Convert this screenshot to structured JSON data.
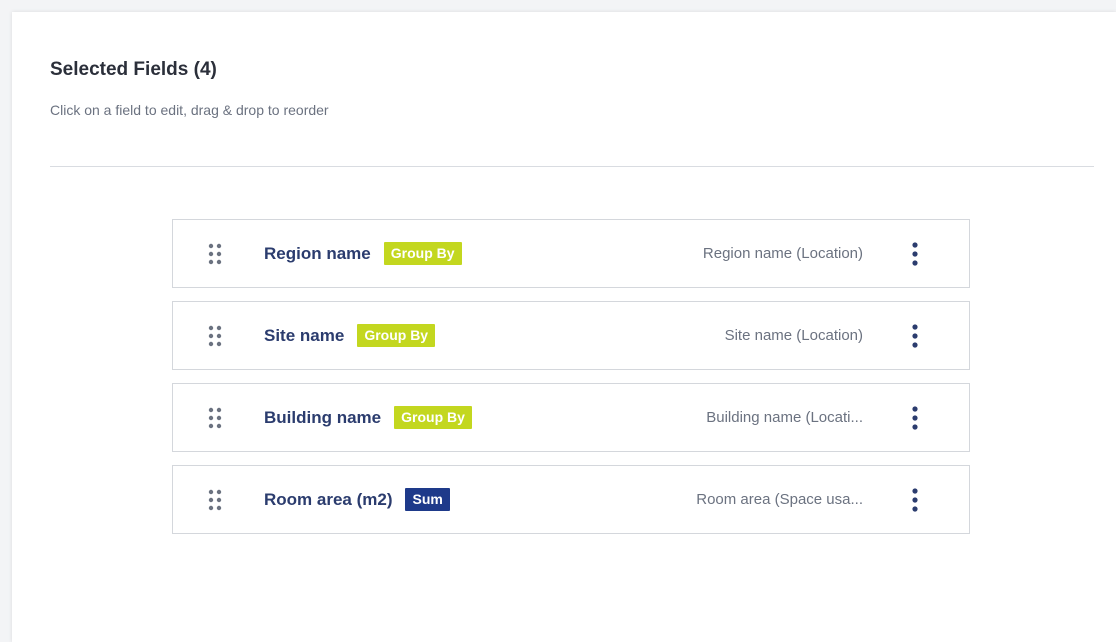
{
  "header": {
    "title": "Selected Fields (4)",
    "subtitle": "Click on a field to edit, drag & drop to reorder"
  },
  "colors": {
    "group_by_badge": "#c3d71f",
    "sum_badge": "#1e3a8a",
    "field_name": "#2b3c6e",
    "kebab": "#2b3c6e"
  },
  "fields": [
    {
      "name": "Region name",
      "badge": "Group By",
      "badge_type": "group-by",
      "source": "Region name (Location)",
      "menu_icon": "more-vertical-icon",
      "drag_icon": "drag-handle-icon"
    },
    {
      "name": "Site name",
      "badge": "Group By",
      "badge_type": "group-by",
      "source": "Site name (Location)",
      "menu_icon": "more-vertical-icon",
      "drag_icon": "drag-handle-icon"
    },
    {
      "name": "Building name",
      "badge": "Group By",
      "badge_type": "group-by",
      "source": "Building name (Locati...",
      "menu_icon": "more-vertical-icon",
      "drag_icon": "drag-handle-icon"
    },
    {
      "name": "Room area (m2)",
      "badge": "Sum",
      "badge_type": "sum",
      "source": "Room area (Space usa...",
      "menu_icon": "more-vertical-icon",
      "drag_icon": "drag-handle-icon"
    }
  ]
}
